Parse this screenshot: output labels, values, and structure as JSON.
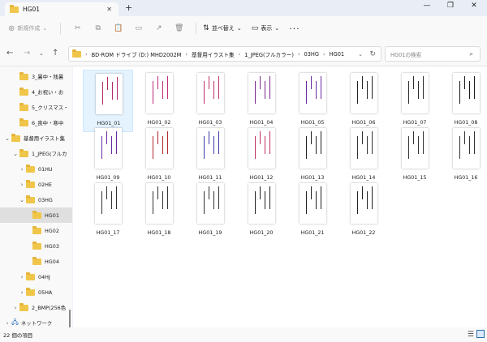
{
  "window": {
    "tab_title": "HG01"
  },
  "toolbar": {
    "new_label": "新規作成",
    "sort_label": "並べ替え",
    "view_label": "表示"
  },
  "address": {
    "crumbs": [
      "BD-ROM ドライブ (D:) MHD2002M",
      "基督用イラスト集",
      "1_JPEG(フルカラー)",
      "03HG",
      "HG01"
    ]
  },
  "search": {
    "placeholder": "HG01の検索"
  },
  "sidebar": {
    "items": [
      {
        "label": "3_暑中・残暑",
        "chevron": "",
        "indent": 1
      },
      {
        "label": "4_お祝い・お",
        "chevron": "",
        "indent": 1
      },
      {
        "label": "5_クリスマス・",
        "chevron": "",
        "indent": 1
      },
      {
        "label": "6_喪中・寒中",
        "chevron": "",
        "indent": 1
      },
      {
        "label": "基督用イラスト集",
        "chevron": "⌄",
        "indent": 0
      },
      {
        "label": "1_JPEG(フルカ",
        "chevron": "⌄",
        "indent": 1
      },
      {
        "label": "01HU",
        "chevron": "›",
        "indent": 2
      },
      {
        "label": "02HE",
        "chevron": "›",
        "indent": 2
      },
      {
        "label": "03HG",
        "chevron": "⌄",
        "indent": 2
      },
      {
        "label": "HG01",
        "chevron": "",
        "indent": 3,
        "selected": true
      },
      {
        "label": "HG02",
        "chevron": "",
        "indent": 3
      },
      {
        "label": "HG03",
        "chevron": "",
        "indent": 3
      },
      {
        "label": "HG04",
        "chevron": "",
        "indent": 3
      },
      {
        "label": "04HJ",
        "chevron": "›",
        "indent": 2
      },
      {
        "label": "05HA",
        "chevron": "›",
        "indent": 2
      },
      {
        "label": "2_BMP(256色",
        "chevron": "›",
        "indent": 1
      },
      {
        "label": "ネットワーク",
        "chevron": "›",
        "indent": 0,
        "network": true
      }
    ]
  },
  "files": [
    {
      "name": "HG01_01",
      "color": "#b0286c"
    },
    {
      "name": "HG01_02",
      "color": "#c02a78"
    },
    {
      "name": "HG01_03",
      "color": "#c0306e"
    },
    {
      "name": "HG01_04",
      "color": "#7a2a8a"
    },
    {
      "name": "HG01_05",
      "color": "#6a2aa0"
    },
    {
      "name": "HG01_06",
      "color": "#222222"
    },
    {
      "name": "HG01_07",
      "color": "#2a2a2a"
    },
    {
      "name": "HG01_08",
      "color": "#1a1a1a"
    },
    {
      "name": "HG01_09",
      "color": "#6a2aa0"
    },
    {
      "name": "HG01_10",
      "color": "#b0282a"
    },
    {
      "name": "HG01_11",
      "color": "#3a3aa8"
    },
    {
      "name": "HG01_12",
      "color": "#c0305e"
    },
    {
      "name": "HG01_13",
      "color": "#222222"
    },
    {
      "name": "HG01_14",
      "color": "#333333"
    },
    {
      "name": "HG01_15",
      "color": "#333333"
    },
    {
      "name": "HG01_16",
      "color": "#333333"
    },
    {
      "name": "HG01_17",
      "color": "#333333"
    },
    {
      "name": "HG01_18",
      "color": "#333333"
    },
    {
      "name": "HG01_19",
      "color": "#333333"
    },
    {
      "name": "HG01_20",
      "color": "#222222"
    },
    {
      "name": "HG01_21",
      "color": "#222222"
    },
    {
      "name": "HG01_22",
      "color": "#222222"
    }
  ],
  "status": {
    "count_text": "22 個の項目"
  }
}
